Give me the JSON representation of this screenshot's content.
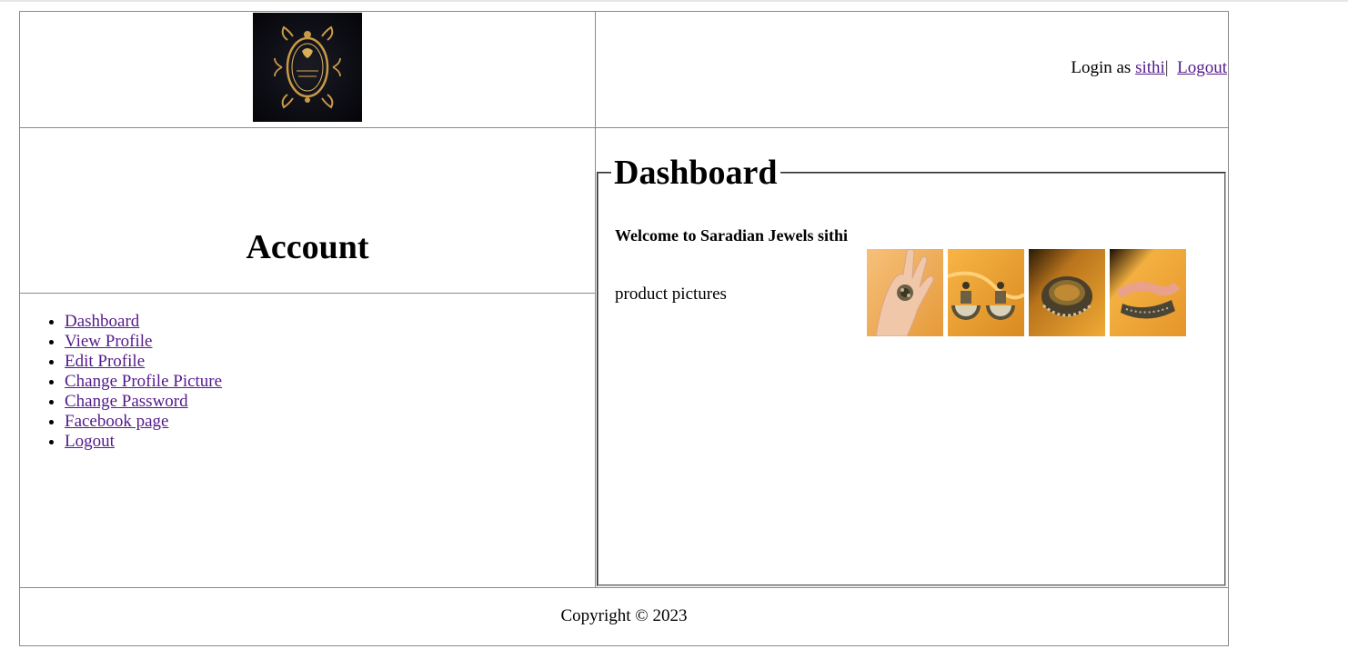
{
  "header": {
    "logo_icon": "saradian-jewels-logo-icon",
    "login_prefix": "Login as",
    "username": "sithi",
    "separator": "|",
    "logout_label": "Logout"
  },
  "sidebar": {
    "title": "Account",
    "items": [
      {
        "label": "Dashboard"
      },
      {
        "label": "View Profile"
      },
      {
        "label": "Edit Profile"
      },
      {
        "label": "Change Profile Picture"
      },
      {
        "label": "Change Password"
      },
      {
        "label": "Facebook page"
      },
      {
        "label": "Logout"
      }
    ]
  },
  "main": {
    "legend": "Dashboard",
    "welcome": "Welcome to Saradian Jewels sithi",
    "products_label": "product pictures",
    "products": [
      {
        "icon": "ring-photo-icon"
      },
      {
        "icon": "earrings-photo-icon"
      },
      {
        "icon": "bangle-photo-icon"
      },
      {
        "icon": "bracelet-photo-icon"
      }
    ]
  },
  "footer": {
    "copyright": "Copyright © 2023"
  },
  "colors": {
    "link": "#551a8b",
    "border": "#8a8a8a",
    "photo_background": "#f2a530"
  }
}
